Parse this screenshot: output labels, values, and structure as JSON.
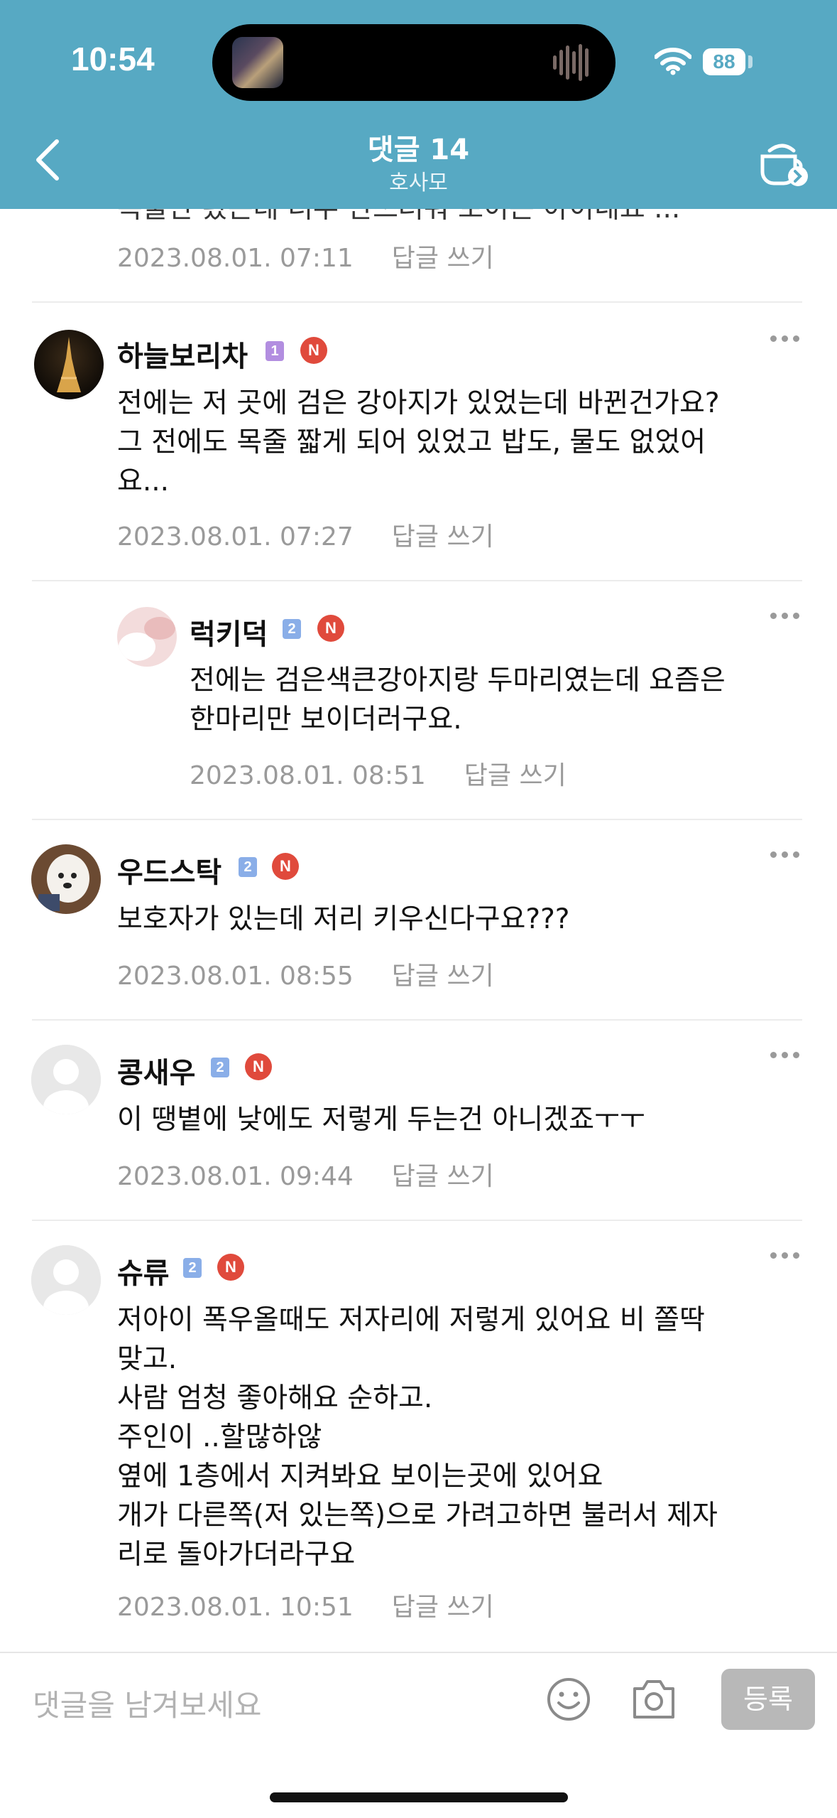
{
  "status_bar": {
    "time": "10:54",
    "battery": "88"
  },
  "header": {
    "title": "댓글 14",
    "subtitle": "호사모"
  },
  "comments": [
    {
      "author": "",
      "lines": [
        "목줄만 봤는데 너무 안쓰러워 보이는 아이네요 ..."
      ],
      "date": "2023.08.01. 07:11",
      "reply_label": "답글 쓰기"
    },
    {
      "author": "하늘보리차",
      "level": "1",
      "new": "N",
      "lines": [
        "전에는 저 곳에 검은 강아지가 있었는데 바뀐건가요?",
        "그 전에도 목줄 짧게 되어 있었고 밥도, 물도 없었어",
        "요..."
      ],
      "date": "2023.08.01. 07:27",
      "reply_label": "답글 쓰기"
    },
    {
      "author": "럭키덕",
      "level": "2",
      "new": "N",
      "lines": [
        "전에는 검은색큰강아지랑 두마리였는데 요즘은",
        "한마리만 보이더러구요."
      ],
      "date": "2023.08.01. 08:51",
      "reply_label": "답글 쓰기"
    },
    {
      "author": "우드스탁",
      "level": "2",
      "new": "N",
      "lines": [
        "보호자가 있는데 저리 키우신다구요???"
      ],
      "date": "2023.08.01. 08:55",
      "reply_label": "답글 쓰기"
    },
    {
      "author": "콩새우",
      "level": "2",
      "new": "N",
      "lines": [
        "이 땡볕에 낮에도 저렇게 두는건 아니겠죠ㅜㅜ"
      ],
      "date": "2023.08.01. 09:44",
      "reply_label": "답글 쓰기"
    },
    {
      "author": "슈류",
      "level": "2",
      "new": "N",
      "lines": [
        "저아이 폭우올때도 저자리에 저렇게 있어요 비 쫄딱",
        "맞고.",
        "사람 엄청 좋아해요 순하고.",
        "주인이 ..할많하않",
        "옆에 1층에서 지켜봐요 보이는곳에 있어요",
        "개가 다른쪽(저 있는쪽)으로 가려고하면 불러서 제자",
        "리로 돌아가더라구요"
      ],
      "date": "2023.08.01. 10:51",
      "reply_label": "답글 쓰기"
    }
  ],
  "composer": {
    "placeholder": "댓글을 남겨보세요",
    "submit_label": "등록"
  },
  "colors": {
    "header": "#57a9c3",
    "new_badge": "#e04a3c",
    "level1": "#b28ee0",
    "level2": "#8aaee8"
  }
}
